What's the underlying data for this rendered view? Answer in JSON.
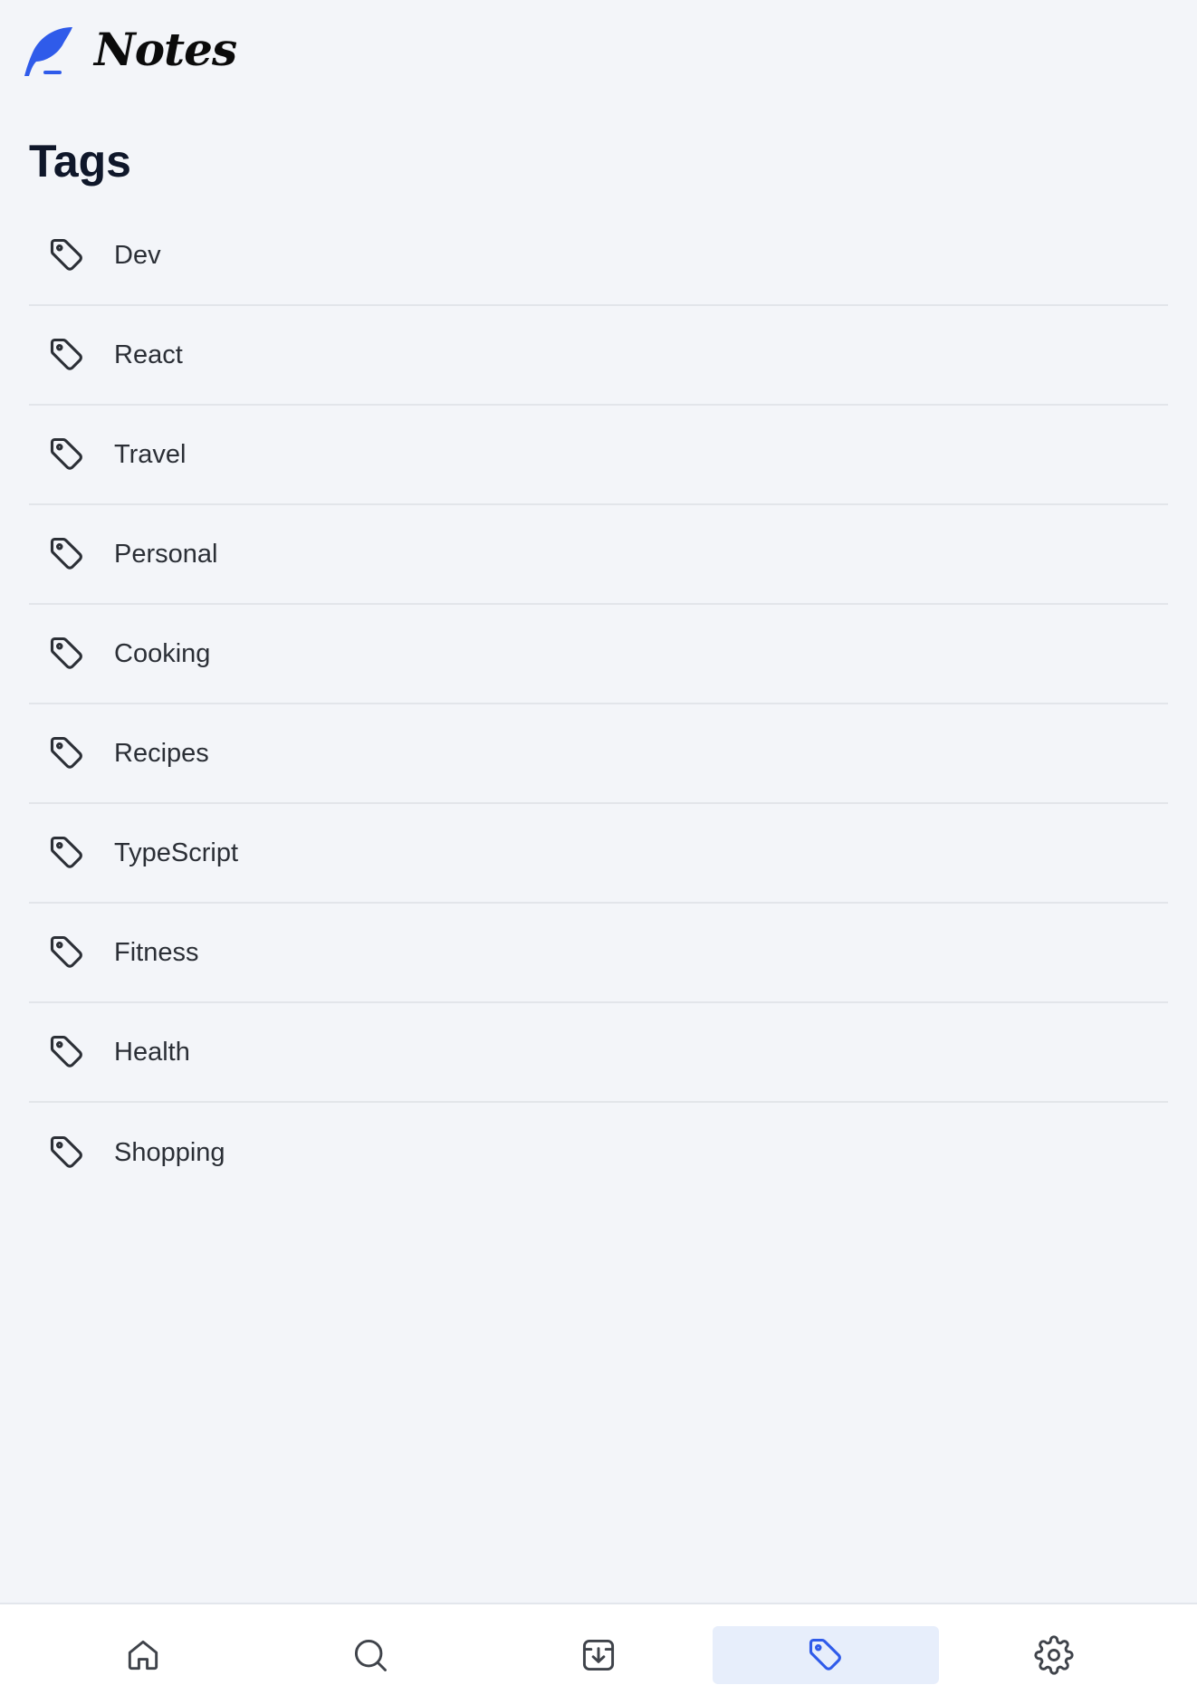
{
  "app": {
    "name": "Notes",
    "accent_color": "#2f5bea"
  },
  "page": {
    "title": "Tags"
  },
  "tags": [
    {
      "label": "Dev",
      "icon": "tag-icon"
    },
    {
      "label": "React",
      "icon": "tag-icon"
    },
    {
      "label": "Travel",
      "icon": "tag-icon"
    },
    {
      "label": "Personal",
      "icon": "tag-icon"
    },
    {
      "label": "Cooking",
      "icon": "tag-icon"
    },
    {
      "label": "Recipes",
      "icon": "tag-icon"
    },
    {
      "label": "TypeScript",
      "icon": "tag-icon"
    },
    {
      "label": "Fitness",
      "icon": "tag-icon"
    },
    {
      "label": "Health",
      "icon": "tag-icon"
    },
    {
      "label": "Shopping",
      "icon": "tag-icon"
    }
  ],
  "bottom_nav": {
    "items": [
      {
        "icon": "home-icon",
        "active": false
      },
      {
        "icon": "search-icon",
        "active": false
      },
      {
        "icon": "inbox-download-icon",
        "active": false
      },
      {
        "icon": "tag-icon",
        "active": true
      },
      {
        "icon": "gear-icon",
        "active": false
      }
    ],
    "active_color": "#2f5bea",
    "inactive_color": "#3f434a"
  }
}
